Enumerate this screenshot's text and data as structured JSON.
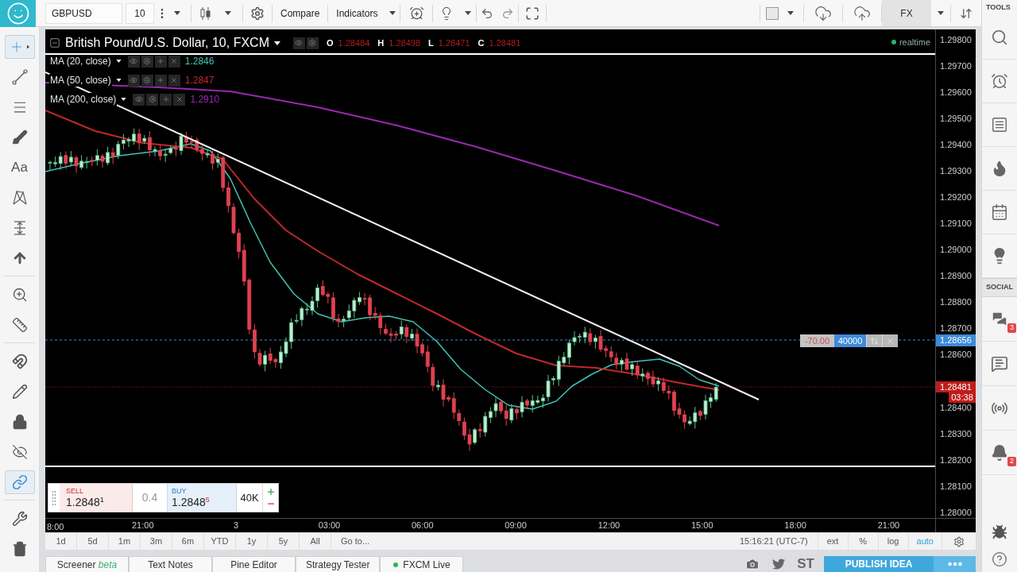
{
  "top_toolbar": {
    "symbol": "GBPUSD",
    "interval": "10",
    "buttons": [
      {
        "label": "Compare",
        "dropdown": false
      },
      {
        "label": "Indicators",
        "dropdown": true
      }
    ],
    "exchange": "FX"
  },
  "left_toolbar": {
    "groups": [
      [
        {
          "kind": "crosshair",
          "selected": true
        },
        {
          "kind": "trend-line",
          "selected": false
        },
        {
          "kind": "parallel-lines",
          "selected": false
        },
        {
          "kind": "brush",
          "selected": false
        },
        {
          "kind": "text",
          "label": "Aa",
          "selected": false
        },
        {
          "kind": "pattern",
          "selected": false
        },
        {
          "kind": "measure",
          "selected": false
        },
        {
          "kind": "arrow",
          "selected": false
        }
      ],
      [
        {
          "kind": "zoom",
          "selected": false
        },
        {
          "kind": "ruler",
          "selected": false
        }
      ],
      [
        {
          "kind": "magnet",
          "selected": false
        },
        {
          "kind": "pencil",
          "selected": false
        },
        {
          "kind": "lock",
          "selected": false
        },
        {
          "kind": "hide",
          "selected": false
        },
        {
          "kind": "link",
          "selected": true
        }
      ],
      [
        {
          "kind": "wrench",
          "selected": false
        },
        {
          "kind": "trash",
          "selected": false
        }
      ]
    ]
  },
  "chart": {
    "title": "British Pound/U.S. Dollar, 10, FXCM",
    "ohlc": [
      {
        "key": "O",
        "value": "1.28484"
      },
      {
        "key": "H",
        "value": "1.28498"
      },
      {
        "key": "L",
        "value": "1.28471"
      },
      {
        "key": "C",
        "value": "1.28481"
      }
    ],
    "status": "realtime",
    "indicators": [
      {
        "name": "MA (20, close)",
        "value": "1.2846",
        "color": "#3fc4b4"
      },
      {
        "name": "MA (50, close)",
        "value": "1.2847",
        "color": "#c0282c"
      },
      {
        "name": "MA (200, close)",
        "value": "1.2910",
        "color": "#9b27b0"
      }
    ],
    "order": {
      "pnl": "-70.00",
      "quantity": "40000"
    },
    "price_axis": {
      "upper": [
        "1.29800",
        "1.29700",
        "1.29600",
        "1.29500",
        "1.29400",
        "1.29300",
        "1.29200",
        "1.29100",
        "1.29000",
        "1.28900",
        "1.28800",
        "1.28700",
        "1.28600"
      ],
      "lower": [
        "1.28400",
        "1.28300",
        "1.28200",
        "1.28100",
        "1.28000"
      ],
      "order_price": "1.28656",
      "last_price": "1.28481",
      "countdown": "03:38"
    },
    "time_axis": [
      "8:00",
      "21:00",
      "3",
      "03:00",
      "06:00",
      "09:00",
      "12:00",
      "15:00",
      "18:00",
      "21:00"
    ],
    "trade_panel": {
      "sell_label": "SELL",
      "sell_price": "1.2848$^{1}$",
      "spread": "0.4",
      "buy_label": "BUY",
      "buy_price": "1.2848$^{5}$",
      "quantity": "40K"
    }
  },
  "range_bar": {
    "ranges": [
      "1d",
      "5d",
      "1m",
      "3m",
      "6m",
      "YTD",
      "1y",
      "5y",
      "All"
    ],
    "goto": "Go to...",
    "clock": "15:16:21 (UTC-7)",
    "scales": [
      {
        "label": "ext",
        "selected": false
      },
      {
        "label": "%",
        "selected": false
      },
      {
        "label": "log",
        "selected": false
      },
      {
        "label": "auto",
        "selected": true
      }
    ]
  },
  "bottom_panel": {
    "tabs": [
      {
        "label": "Screener",
        "tag": "beta",
        "live": false
      },
      {
        "label": "Text Notes",
        "live": false
      },
      {
        "label": "Pine Editor",
        "live": false
      },
      {
        "label": "Strategy Tester",
        "live": false
      },
      {
        "label": "FXCM Live",
        "live": true
      }
    ],
    "share": "ST",
    "publish": "PUBLISH IDEA"
  },
  "right_sidebar": {
    "sections": [
      {
        "title": "TOOLS",
        "items": [
          {
            "kind": "search"
          },
          {
            "kind": "alarm"
          },
          {
            "kind": "list"
          },
          {
            "kind": "flame"
          },
          {
            "kind": "calendar"
          },
          {
            "kind": "lightbulb"
          }
        ]
      },
      {
        "title": "SOCIAL",
        "items": [
          {
            "kind": "chat",
            "badge": "3"
          },
          {
            "kind": "chat-alt"
          },
          {
            "kind": "broadcast"
          },
          {
            "kind": "bell",
            "badge": "2"
          }
        ]
      }
    ]
  }
}
